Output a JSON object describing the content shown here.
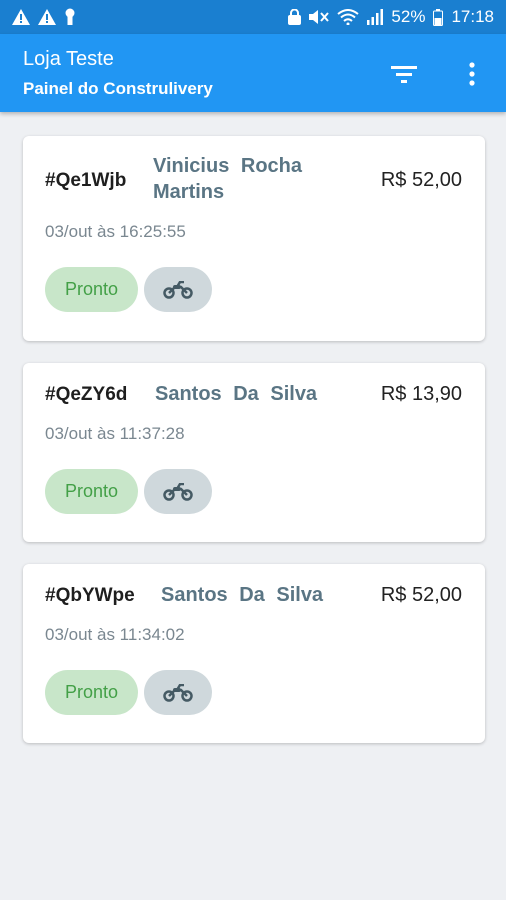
{
  "status_bar": {
    "battery": "52%",
    "time": "17:18",
    "icons": [
      "warning-icon",
      "warning-icon",
      "keyhole-icon",
      "lock-icon",
      "mute-icon",
      "wifi-icon",
      "signal-icon",
      "battery-icon"
    ]
  },
  "app_bar": {
    "title": "Loja Teste",
    "subtitle": "Painel do Construlivery",
    "actions": [
      "filter-icon",
      "more-vert-icon"
    ]
  },
  "orders": [
    {
      "code": "#Qe1Wjb",
      "customer": "Vinicius  Rocha Martins",
      "price": "R$ 52,00",
      "time": "03/out às 16:25:55",
      "status": "Pronto",
      "delivery_icon": "motorcycle-icon"
    },
    {
      "code": "#QeZY6d",
      "customer": "Santos Da Silva",
      "price": "R$ 13,90",
      "time": "03/out às 11:37:28",
      "status": "Pronto",
      "delivery_icon": "motorcycle-icon"
    },
    {
      "code": "#QbYWpe",
      "customer": "Santos Da Silva",
      "price": "R$ 52,00",
      "time": "03/out às 11:34:02",
      "status": "Pronto",
      "delivery_icon": "motorcycle-icon"
    }
  ],
  "colors": {
    "status_bar": "#1a7fd0",
    "app_bar": "#2196f3",
    "background": "#eef0f3",
    "status_chip_bg": "#c8e6c9",
    "status_chip_text": "#43a047",
    "delivery_chip_bg": "#cfd8dc",
    "customer_name": "#5a7584"
  }
}
